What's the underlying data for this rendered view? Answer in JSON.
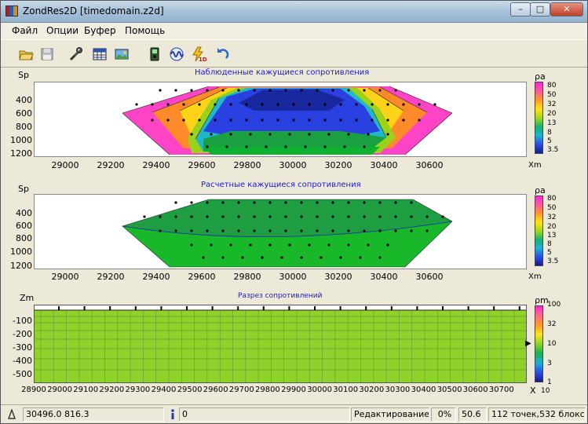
{
  "window": {
    "title": "ZondRes2D [timedomain.z2d]"
  },
  "menu": [
    "Файл",
    "Опции",
    "Буфер",
    "Помощь"
  ],
  "toolbar_icons": [
    "open-folder-icon",
    "save-disk-icon",
    "tools-icon",
    "table-grid-icon",
    "image-icon",
    "device-icon",
    "wave-icon",
    "lightning-1d-icon",
    "undo-arrow-icon"
  ],
  "panels": {
    "observed": {
      "title": "Наблюденные кажущиеся сопротивления",
      "ylabel": "Sp",
      "xunit": "Xm",
      "yticks": [
        "400",
        "600",
        "800",
        "1000",
        "1200"
      ],
      "xticks": [
        "29000",
        "29200",
        "29400",
        "29600",
        "29800",
        "30000",
        "30200",
        "30400",
        "30600"
      ],
      "cb_label": "ρa",
      "cb_ticks": [
        "80",
        "50",
        "32",
        "20",
        "13",
        "8",
        "5",
        "3.5"
      ]
    },
    "calculated": {
      "title": "Расчетные кажущиеся сопротивления",
      "ylabel": "Sp",
      "xunit": "Xm",
      "yticks": [
        "400",
        "600",
        "800",
        "1000",
        "1200"
      ],
      "xticks": [
        "29000",
        "29200",
        "29400",
        "29600",
        "29800",
        "30000",
        "30200",
        "30400",
        "30600"
      ],
      "cb_label": "ρa",
      "cb_ticks": [
        "80",
        "50",
        "32",
        "20",
        "13",
        "8",
        "5",
        "3.5"
      ]
    },
    "section": {
      "title": "Разрез сопротивлений",
      "ylabel": "Zm",
      "xunit": "X",
      "yticks": [
        "-100",
        "-200",
        "-300",
        "-400",
        "-500"
      ],
      "xticks": [
        "28900",
        "29000",
        "29100",
        "29200",
        "29300",
        "29400",
        "29500",
        "29600",
        "29700",
        "29800",
        "29900",
        "30000",
        "30100",
        "30200",
        "30300",
        "30400",
        "30500",
        "30600",
        "30700"
      ],
      "cb_label": "ρm",
      "cb_ticks": [
        "100",
        "32",
        "10",
        "3",
        "1",
        "10"
      ]
    }
  },
  "status": {
    "coords": "30496.0 816.3",
    "info_value": "0",
    "mode": "Редактирование",
    "percent": "0%",
    "value": "50.6",
    "summary": "112 точек,532 блокс"
  },
  "colors": {
    "title_text": "#1a1ad0",
    "section_fill": "#8fd22a",
    "section_grid": "#6b9e3a"
  }
}
